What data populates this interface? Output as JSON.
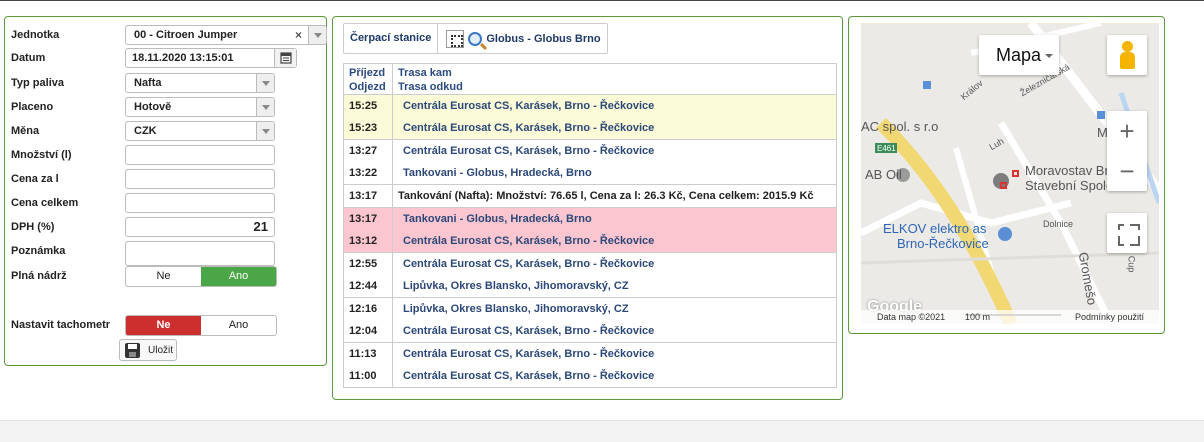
{
  "form": {
    "rows": [
      {
        "label": "Jednotka",
        "value": "00 - Citroen Jumper"
      },
      {
        "label": "Datum",
        "value": "18.11.2020 13:15:01"
      },
      {
        "label": "Typ paliva",
        "value": "Nafta"
      },
      {
        "label": "Placeno",
        "value": "Hotově"
      },
      {
        "label": "Měna",
        "value": "CZK"
      },
      {
        "label": "Množství (l)",
        "value": ""
      },
      {
        "label": "Cena za l",
        "value": ""
      },
      {
        "label": "Cena celkem",
        "value": ""
      },
      {
        "label": "DPH (%)",
        "value": "21"
      },
      {
        "label": "Poznámka",
        "value": ""
      },
      {
        "label": "Plná nádrž",
        "no": "Ne",
        "yes": "Ano",
        "selected": "Ano"
      },
      {
        "label": "Nastavit tachometr",
        "no": "Ne",
        "yes": "Ano",
        "selected": "Ne"
      }
    ],
    "clear_symbol": "×",
    "save_label": "Uložit"
  },
  "station": {
    "tab_label": "Čerpací stanice",
    "name": "Globus - Globus Brno"
  },
  "trips": {
    "headers": {
      "arrive": "Příjezd",
      "depart": "Odjezd",
      "to": "Trasa kam",
      "from": "Trasa odkud"
    },
    "rows": [
      {
        "time": "15:25",
        "route": "Centrála Eurosat CS, Karásek, Brno - Řečkovice",
        "style": "yellow",
        "top": true
      },
      {
        "time": "15:23",
        "route": "Centrála Eurosat CS, Karásek, Brno - Řečkovice",
        "style": "yellow",
        "top": false
      },
      {
        "time": "13:27",
        "route": "Centrála Eurosat CS, Karásek, Brno - Řečkovice",
        "style": "white",
        "top": true
      },
      {
        "time": "13:22",
        "route": "Tankovani - Globus, Hradecká, Brno",
        "style": "white",
        "top": false
      },
      {
        "time": "13:17",
        "route": "Tankování (Nafta): Množství: 76.65 l, Cena za l: 26.3 Kč, Cena celkem: 2015.9 Kč",
        "style": "white",
        "top": true,
        "full": true
      },
      {
        "time": "13:17",
        "route": "Tankovani - Globus, Hradecká, Brno",
        "style": "pink",
        "top": true
      },
      {
        "time": "13:12",
        "route": "Centrála Eurosat CS, Karásek, Brno - Řečkovice",
        "style": "pink",
        "top": false
      },
      {
        "time": "12:55",
        "route": "Centrála Eurosat CS, Karásek, Brno - Řečkovice",
        "style": "white",
        "top": true
      },
      {
        "time": "12:44",
        "route": "Lipůvka, Okres Blansko, Jihomoravský, CZ",
        "style": "white",
        "top": false
      },
      {
        "time": "12:16",
        "route": "Lipůvka, Okres Blansko, Jihomoravský, CZ",
        "style": "white",
        "top": true
      },
      {
        "time": "12:04",
        "route": "Centrála Eurosat CS, Karásek, Brno - Řečkovice",
        "style": "white",
        "top": false
      },
      {
        "time": "11:13",
        "route": "Centrála Eurosat CS, Karásek, Brno - Řečkovice",
        "style": "white",
        "top": true
      },
      {
        "time": "11:00",
        "route": "Centrála Eurosat CS, Karásek, Brno - Řečkovice",
        "style": "white",
        "top": false
      }
    ]
  },
  "map": {
    "type_label": "Mapa",
    "zoom_in": "+",
    "zoom_out": "−",
    "labels": {
      "ac": "AC spol. s r.o",
      "ab_oil": "AB Oil",
      "mora": "Mora",
      "moravostav_1": "Moravostav Brn",
      "moravostav_2": "Stavební Spolec",
      "elkov_1": "ELKOV elektro as",
      "elkov_2": "Brno-Řečkovice",
      "road": "E461",
      "kralov": "Králov",
      "zeleznicarska": "Železničářská",
      "luh": "Luh",
      "dolnice": "Dolnice",
      "gromesova": "Gromešo",
      "cupak": "Cup",
      "google": "Google"
    },
    "attribution": {
      "data": "Data map ©2021",
      "scale": "100 m",
      "terms": "Podmínky použití"
    },
    "accent": "#2e66b7"
  }
}
